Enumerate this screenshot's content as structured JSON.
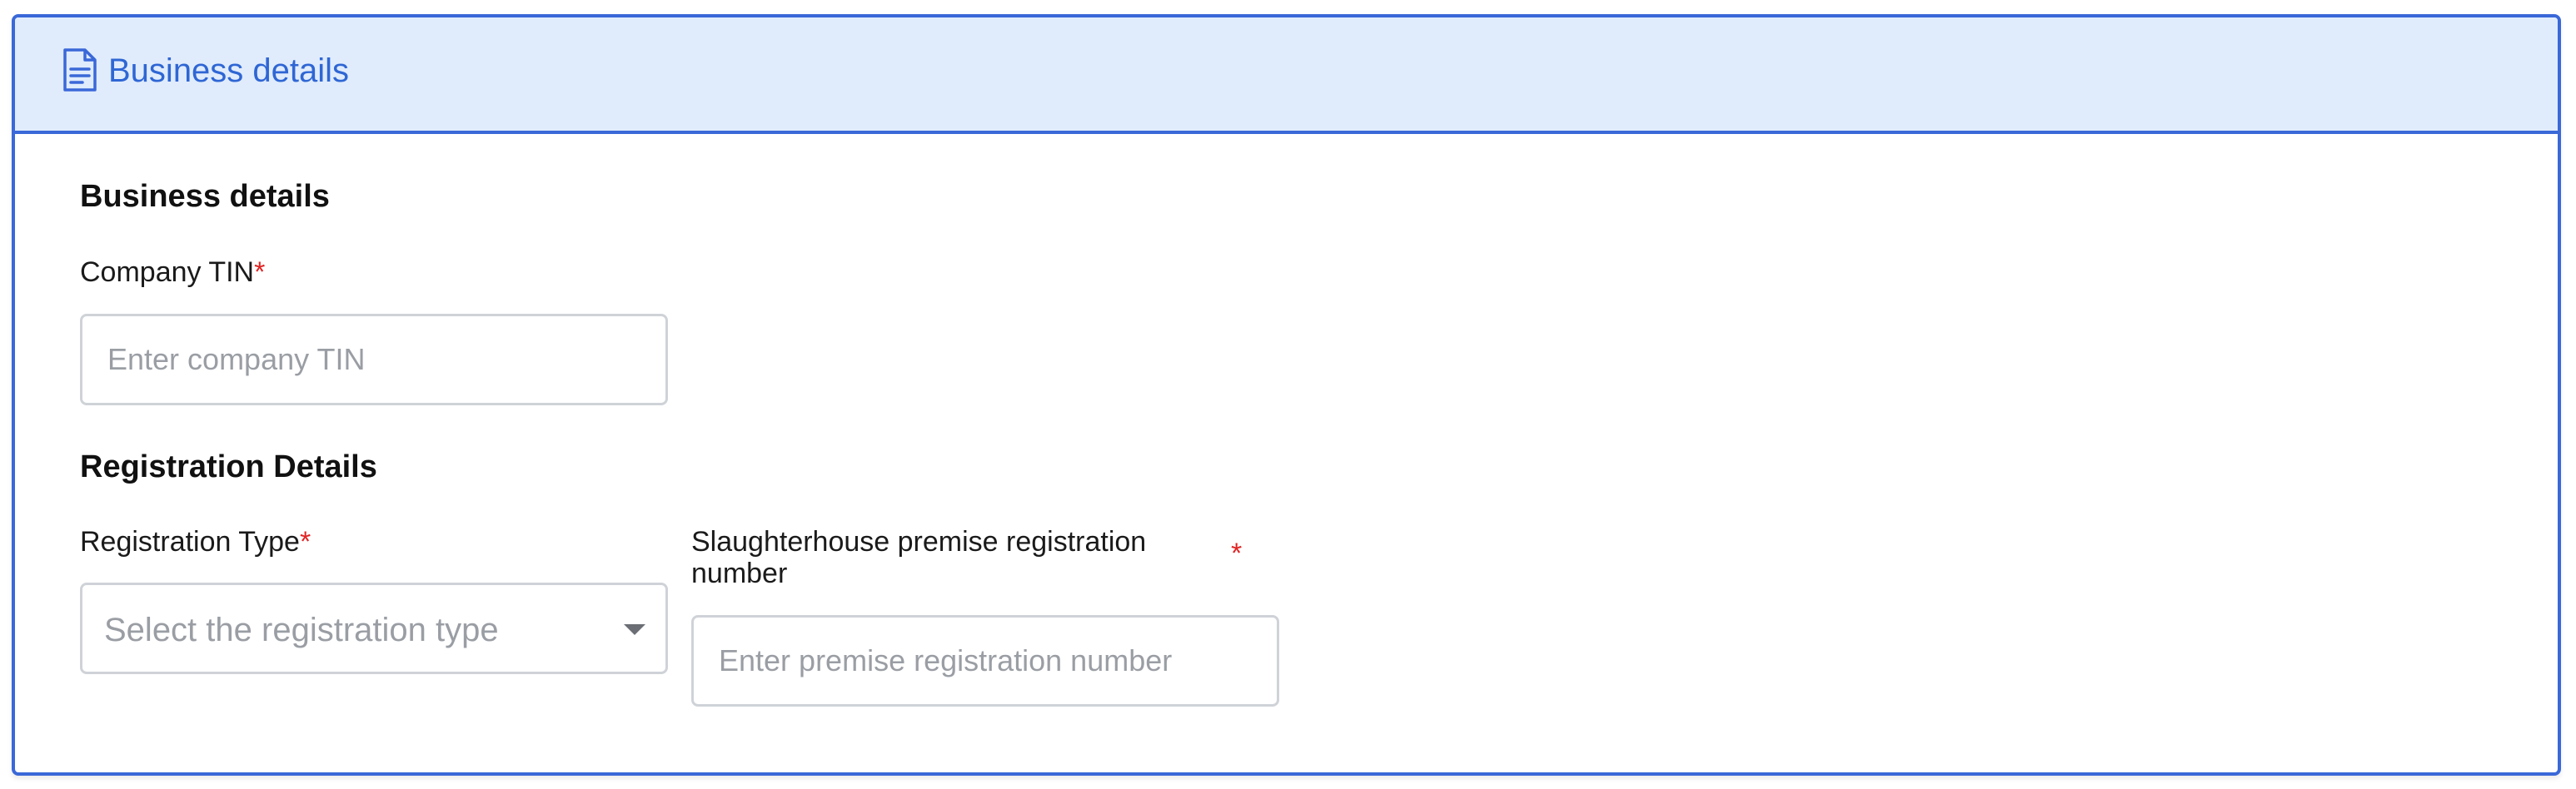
{
  "panel": {
    "header_title": "Business details",
    "header_icon": "document-icon",
    "accent_color": "#3a68d8",
    "header_bg": "#e0ecfc"
  },
  "business_section": {
    "title": "Business details",
    "company_tin": {
      "label": "Company TIN",
      "required_mark": "*",
      "placeholder": "Enter company TIN",
      "value": ""
    }
  },
  "registration_section": {
    "title": "Registration Details",
    "registration_type": {
      "label": "Registration Type",
      "required_mark": "*",
      "placeholder": "Select the registration type",
      "icon": "caret-down-icon"
    },
    "premise_number": {
      "label_line1": "Slaughterhouse premise registration",
      "label_line2": "number",
      "required_mark": "*",
      "placeholder": "Enter premise registration number",
      "value": ""
    }
  }
}
